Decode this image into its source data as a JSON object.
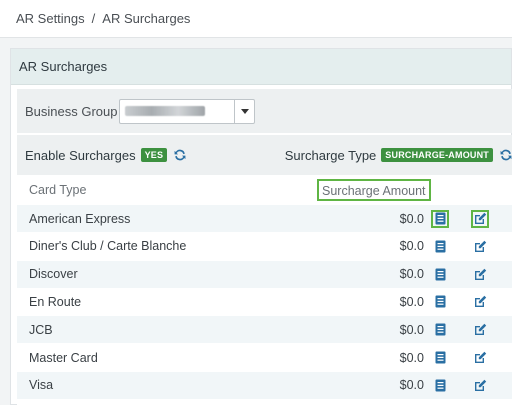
{
  "breadcrumb": {
    "parent": "AR Settings",
    "separator": "/",
    "current": "AR Surcharges"
  },
  "panel": {
    "title": "AR Surcharges"
  },
  "business_group": {
    "label": "Business Group",
    "value": ""
  },
  "options": {
    "enable_label": "Enable Surcharges",
    "enable_badge": "YES",
    "type_label": "Surcharge Type",
    "type_badge": "SURCHARGE-AMOUNT"
  },
  "table": {
    "columns": {
      "card_type": "Card Type",
      "amount": "Surcharge Amount"
    },
    "rows": [
      {
        "card": "American Express",
        "amount": "$0.0"
      },
      {
        "card": "Diner's Club / Carte Blanche",
        "amount": "$0.0"
      },
      {
        "card": "Discover",
        "amount": "$0.0"
      },
      {
        "card": "En Route",
        "amount": "$0.0"
      },
      {
        "card": "JCB",
        "amount": "$0.0"
      },
      {
        "card": "Master Card",
        "amount": "$0.0"
      },
      {
        "card": "Visa",
        "amount": "$0.0"
      }
    ]
  },
  "colors": {
    "accent": "#2a6fa3",
    "badge": "#3d9140",
    "highlight": "#5fb544",
    "header_bg": "#e4eeee"
  },
  "icons": {
    "refresh": "refresh-icon",
    "details": "document-icon",
    "edit": "edit-icon",
    "dropdown": "chevron-down-icon"
  }
}
